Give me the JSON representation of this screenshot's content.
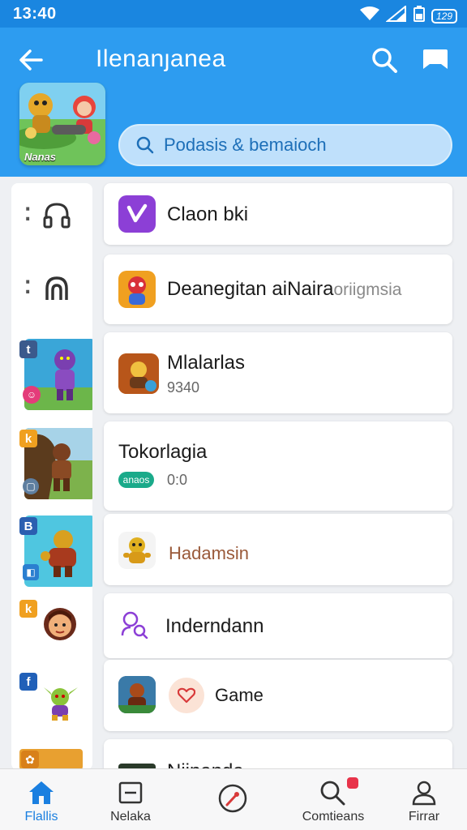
{
  "status_bar": {
    "time": "13:40",
    "battery_label": "129"
  },
  "header": {
    "title": "Ilenanȷanea",
    "search_placeholder": "Podasis & bemaioch",
    "game_art_caption": "Nanas"
  },
  "rail": {
    "items": [
      {
        "badge": ""
      },
      {
        "badge": ""
      },
      {
        "badge": "t",
        "mini": "☺"
      },
      {
        "badge": "k",
        "mini": "▢"
      },
      {
        "badge": "B",
        "mini": "◧"
      },
      {
        "badge": "k"
      },
      {
        "badge": "f"
      },
      {
        "badge": "✿"
      }
    ]
  },
  "list": {
    "items": [
      {
        "title": "Claon bki"
      },
      {
        "title": "Deanegitan aiNaira",
        "title_suffix": "oriigmsia"
      },
      {
        "title": "Mlalarlas",
        "subtitle": "9340"
      },
      {
        "title": "Tokorlagia",
        "subtitle": "0:0",
        "tag": "anaos"
      },
      {
        "title": "Hadamsin"
      },
      {
        "title": "Inderndann"
      },
      {
        "title": "Game"
      },
      {
        "title": "Niinanda"
      }
    ]
  },
  "bottom_nav": {
    "items": [
      {
        "label": "Flallis",
        "icon": "home-icon",
        "active": true
      },
      {
        "label": "Nelaka",
        "icon": "inbox-icon"
      },
      {
        "label": "",
        "icon": "compass-icon"
      },
      {
        "label": "Comtieans",
        "icon": "search-icon",
        "notification": true
      },
      {
        "label": "Firrar",
        "icon": "profile-icon"
      }
    ]
  },
  "colors": {
    "header": "#2d9cf0",
    "status_bar": "#1a86e0",
    "active": "#1a7fe0",
    "accent_purple": "#8c3fd6",
    "accent_green": "#1aaa8a"
  }
}
